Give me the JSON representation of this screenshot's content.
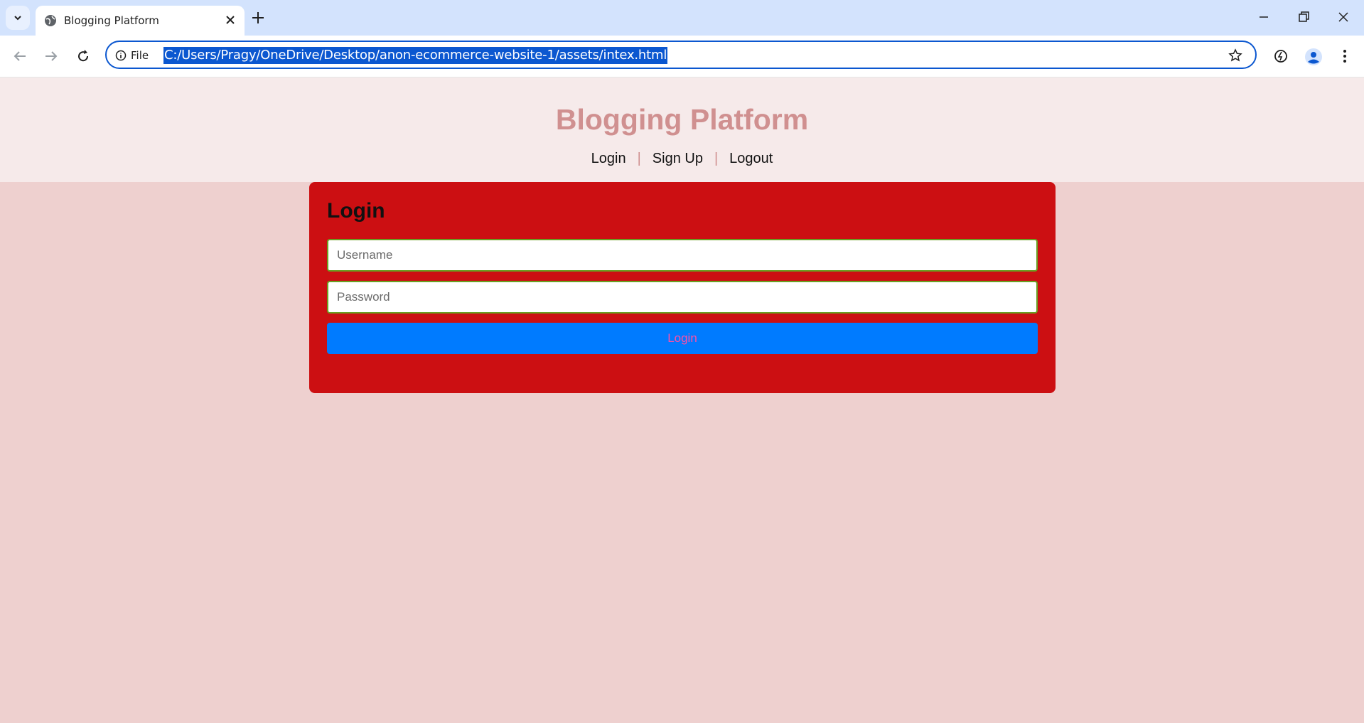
{
  "browser": {
    "tab_title": "Blogging Platform",
    "site_info_label": "File",
    "url": "C:/Users/Pragy/OneDrive/Desktop/anon-ecommerce-website-1/assets/intex.html"
  },
  "header": {
    "title": "Blogging Platform",
    "nav": {
      "login": "Login",
      "signup": "Sign Up",
      "logout": "Logout",
      "separator": "|"
    }
  },
  "login_form": {
    "heading": "Login",
    "username_placeholder": "Username",
    "password_placeholder": "Password",
    "submit_label": "Login"
  },
  "colors": {
    "page_bg": "#eed0cf",
    "header_bg": "#f6eaea",
    "title_color": "#d09090",
    "card_bg": "#cc0f12",
    "button_bg": "#007bff",
    "button_text": "#ff4fa3",
    "input_border": "#6a9f22",
    "omnibox_accent": "#0b57d0"
  }
}
